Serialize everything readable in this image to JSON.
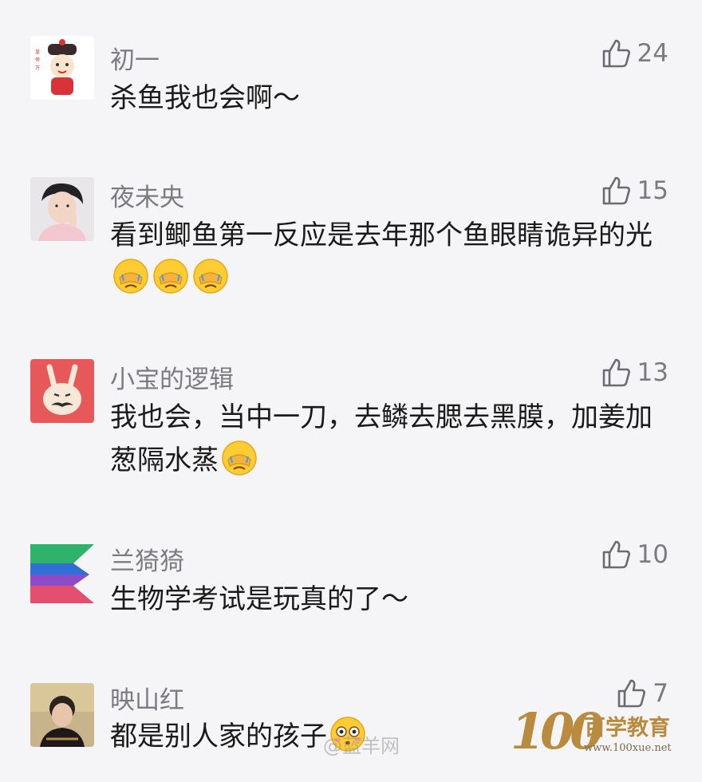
{
  "comments": [
    {
      "username": "初一",
      "likes": "24",
      "text": "杀鱼我也会啊～",
      "avatar": "qing-official-cartoon-avatar"
    },
    {
      "username": "夜未央",
      "likes": "15",
      "text": "看到鲫鱼第一反应是去年那个鱼眼睛诡异的光",
      "avatar": "young-man-photo-avatar",
      "emoji_count": 3
    },
    {
      "username": "小宝的逻辑",
      "likes": "13",
      "text": "我也会，当中一刀，去鳞去腮去黑膜，加姜加葱隔水蒸",
      "avatar": "rabbit-mustache-avatar",
      "emoji_count": 1
    },
    {
      "username": "兰猗猗",
      "likes": "10",
      "text": "生物学考试是玩真的了～",
      "avatar": "colorful-play-logo-avatar"
    },
    {
      "username": "映山红",
      "likes": "7",
      "text": "都是别人家的孩子",
      "avatar": "elderly-woman-photo-avatar",
      "emoji_count": 1
    }
  ],
  "icons": {
    "like": "thumbs-up-icon",
    "facepalm_emoji": "facepalm-emoji-icon",
    "flushed_emoji": "flushed-emoji-icon"
  },
  "watermark": "@蓝羊网",
  "brand": {
    "mark": "100",
    "name": "百学教育",
    "url": "www.100xue.net"
  },
  "colors": {
    "background": "#f5f4f6",
    "username": "#7b7b80",
    "text": "#1a1a1a",
    "brand": "#b98b3e"
  }
}
